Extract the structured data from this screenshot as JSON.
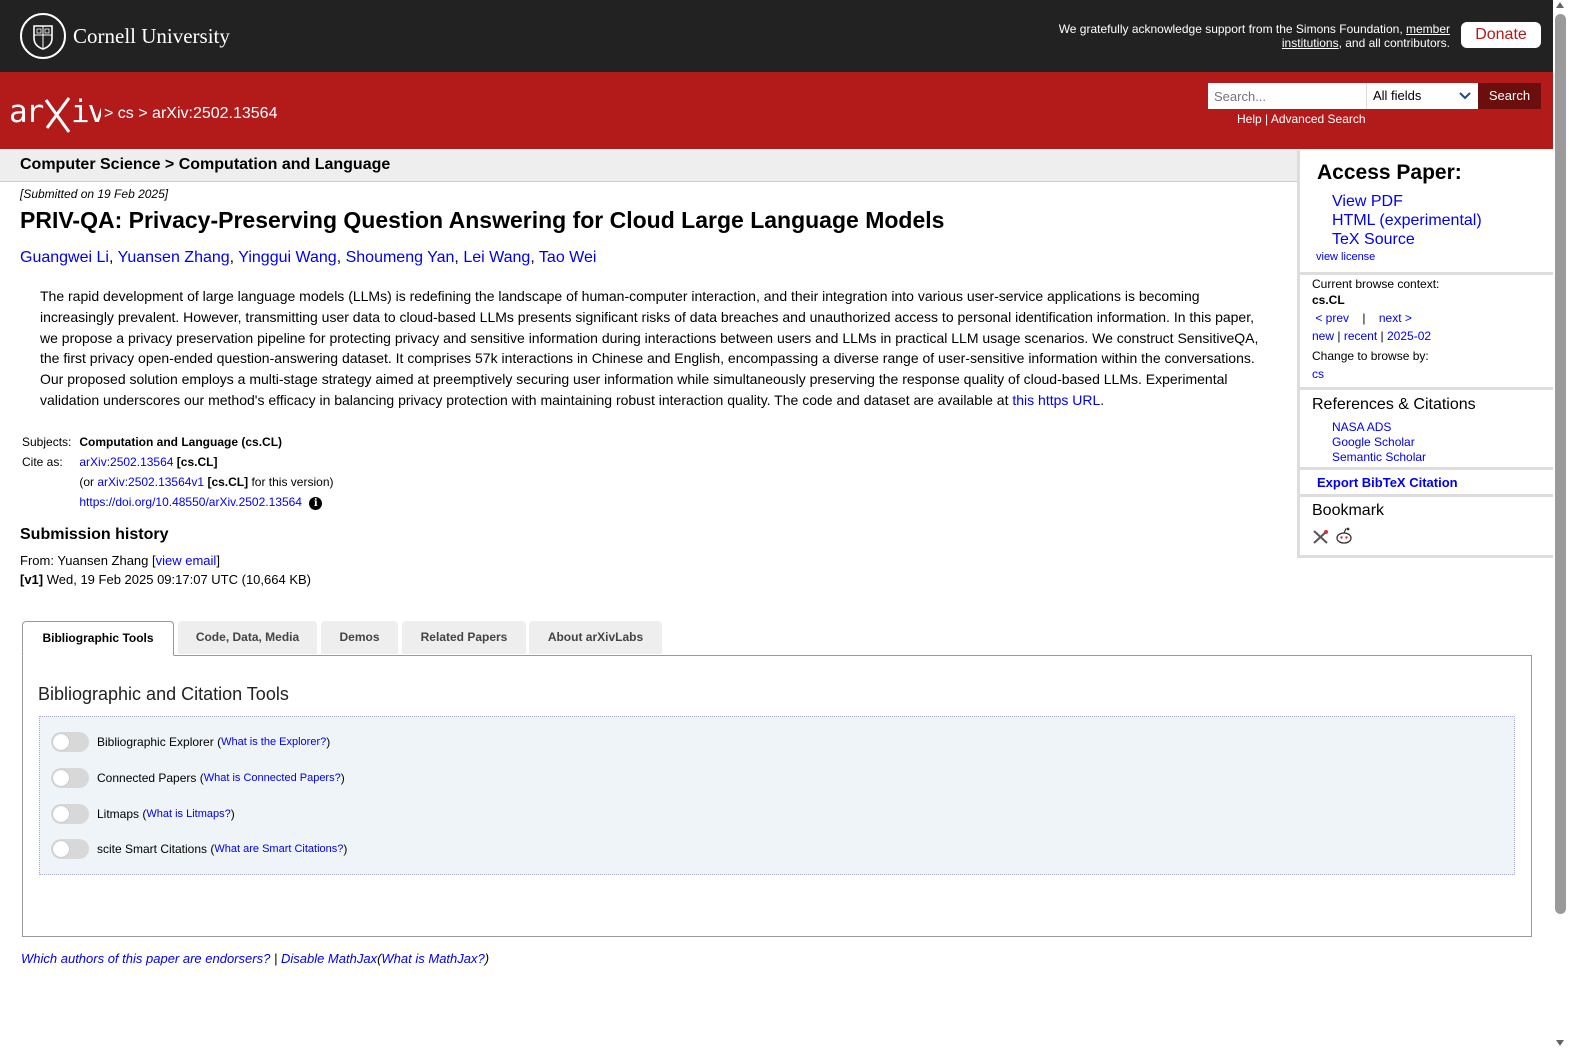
{
  "cornell": {
    "name": "Cornell University",
    "ack_pre": "We gratefully acknowledge support from the Simons Foundation, ",
    "ack_link1": "member institutions",
    "ack_post": ", and all contributors.",
    "donate": "Donate"
  },
  "header": {
    "crumb_sep": ">",
    "crumb_cs": "cs",
    "crumb_id": "arXiv:2502.13564",
    "search_placeholder": "Search...",
    "field_select": "All fields",
    "search_button": "Search",
    "help": "Help",
    "help_sep": "|",
    "advanced": "Advanced Search"
  },
  "category": "Computer Science > Computation and Language",
  "paper": {
    "submitted": "[Submitted on 19 Feb 2025]",
    "title": "PRIV-QA: Privacy-Preserving Question Answering for Cloud Large Language Models",
    "authors": [
      "Guangwei Li",
      "Yuansen Zhang",
      "Yinggui Wang",
      "Shoumeng Yan",
      "Lei Wang",
      "Tao Wei"
    ],
    "abstract": "The rapid development of large language models (LLMs) is redefining the landscape of human-computer interaction, and their integration into various user-service applications is becoming increasingly prevalent. However, transmitting user data to cloud-based LLMs presents significant risks of data breaches and unauthorized access to personal identification information. In this paper, we propose a privacy preservation pipeline for protecting privacy and sensitive information during interactions between users and LLMs in practical LLM usage scenarios. We construct SensitiveQA, the first privacy open-ended question-answering dataset. It comprises 57k interactions in Chinese and English, encompassing a diverse range of user-sensitive information within the conversations. Our proposed solution employs a multi-stage strategy aimed at preemptively securing user information while simultaneously preserving the response quality of cloud-based LLMs. Experimental validation underscores our method's efficacy in balancing privacy protection with maintaining robust interaction quality. The code and dataset are available at ",
    "abstract_link": "this https URL",
    "abstract_end": "."
  },
  "meta": {
    "subjects_label": "Subjects:",
    "subjects_value": "Computation and Language (cs.CL)",
    "cite_label": "Cite as:",
    "cite_id": "arXiv:2502.13564",
    "cite_tag": "[cs.CL]",
    "or_pre": "(or ",
    "or_id": "arXiv:2502.13564v1",
    "or_tag": "[cs.CL]",
    "or_post": " for this version)",
    "doi": "https://doi.org/10.48550/arXiv.2502.13564"
  },
  "history": {
    "heading": "Submission history",
    "from_pre": "From: Yuansen Zhang [",
    "view_email": "view email",
    "from_post": "]",
    "v1": "[v1]",
    "v1_text": " Wed, 19 Feb 2025 09:17:07 UTC (10,664 KB)"
  },
  "sidebar": {
    "access_heading": "Access Paper:",
    "access_links": [
      "View PDF",
      "HTML (experimental)",
      "TeX Source"
    ],
    "view_license": "view license",
    "context_label": "Current browse context:",
    "context_value": "cs.CL",
    "prev": "< prev",
    "nav_sep": "|",
    "next": "next >",
    "new": "new",
    "recent": "recent",
    "month": "2025-02",
    "change_label": "Change to browse by:",
    "change_cs": "cs",
    "refs_heading": "References & Citations",
    "refs": [
      "NASA ADS",
      "Google Scholar",
      "Semantic Scholar"
    ],
    "export": "Export BibTeX Citation",
    "bookmark": "Bookmark"
  },
  "tabs": [
    "Bibliographic Tools",
    "Code, Data, Media",
    "Demos",
    "Related Papers",
    "About arXivLabs"
  ],
  "panel": {
    "heading": "Bibliographic and Citation Tools",
    "tools": [
      {
        "name": "Bibliographic Explorer",
        "link": "What is the Explorer?"
      },
      {
        "name": "Connected Papers",
        "link": "What is Connected Papers?"
      },
      {
        "name": "Litmaps",
        "link": "What is Litmaps?"
      },
      {
        "name": "scite Smart Citations",
        "link": "What are Smart Citations?"
      }
    ]
  },
  "footer": {
    "endorsers": "Which authors of this paper are endorsers?",
    "sep": "|",
    "disable": "Disable MathJax",
    "what_pre": "(",
    "what": "What is MathJax?",
    "what_post": ")"
  },
  "colors": {
    "brand_red": "#b31b1b",
    "top_bar": "#222222",
    "link": "#0000ee"
  }
}
